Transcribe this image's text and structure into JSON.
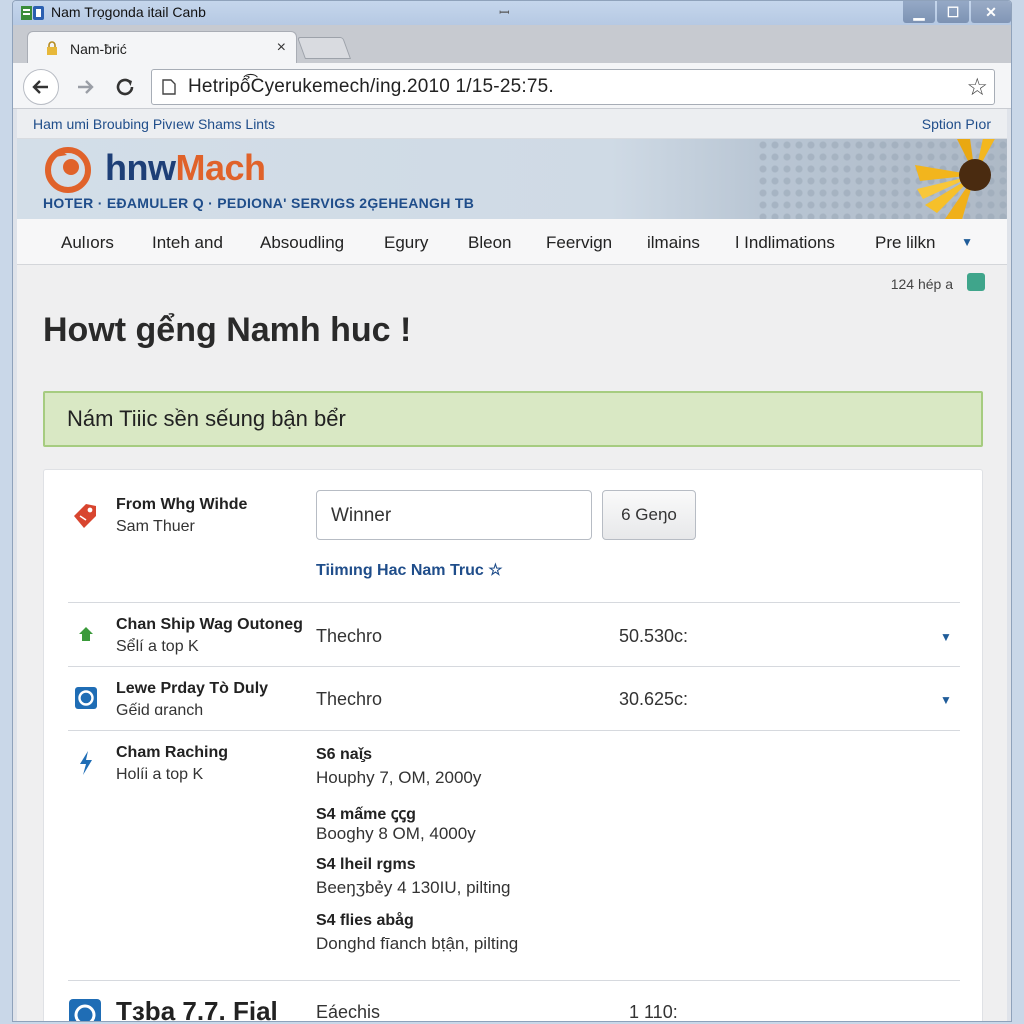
{
  "window": {
    "title": "Nam Trọgonda itail Canb",
    "mid_glyph": "ꟷ"
  },
  "tab": {
    "label": "Nam-ƀrić",
    "close": "×"
  },
  "toolbar": {
    "url": "Hetripổ͡Cyerukemech/ing.2010 1/15-25:75.",
    "star": "☆"
  },
  "page": {
    "topstrip": {
      "left": "Ham umi Broubing Pivıew Shams Lints",
      "right": "Sption Pıor"
    },
    "logo": {
      "part1": "hnw",
      "part2": "Mach"
    },
    "tagline": "HOTER  ·  EĐAMULER Q  ·  PEDIONA' SERVIGS    2ĢEHEANGH TB",
    "menu": [
      "Aulıors",
      "Inteh and",
      "Absoudling",
      "Egury",
      "Bleon",
      "Feervign",
      "ilmains",
      "ǀ Indlimations",
      "Pre lilkn"
    ],
    "subinfo": "124 hép a",
    "headline": "Howt gểng Namh huc !",
    "notice": "Nám Tiiic sền sếung bận bểr",
    "form": {
      "title": "From Whg Wihde",
      "subtitle": "Sam Thuer",
      "input_value": "Winner",
      "button": "6 Geŋo",
      "link": "Tiimıng Hac Nam Truc ☆"
    },
    "rows": [
      {
        "title": "Chan Ship Wag Outoneg",
        "subtitle": "Sểlí a top K",
        "value": "Thechro",
        "amount": "50.530c:"
      },
      {
        "title": "Lewe Prday Tò Duly",
        "subtitle": "Gếid ɑranch",
        "value": "Thechro",
        "amount": "30.625c:"
      }
    ],
    "detail": {
      "title": "Cham Raching",
      "subtitle": "Holíi a top K",
      "items": [
        {
          "h": "S6 naǐ̧s",
          "v": "Houphy 7, OM, 2000y"
        },
        {
          "h": "S4 mấme ꞔꞔg",
          "v": "Booghy 8 OM, 4000y"
        },
        {
          "h": "S4 lheil rgms",
          "v": "Beeŋʒbẻy 4 130IU, pilting"
        },
        {
          "h": "S4 flies abåg",
          "v": "Donghd fīanch bṭận, pilting"
        }
      ]
    },
    "bottom": {
      "title": "Tзba 7.7. Fial",
      "value": "Eáechis",
      "amount": "1 110:"
    }
  },
  "colors": {
    "accent": "#1f4d8a",
    "brand_orange": "#e0622a",
    "notice_bg": "#d9e8c4"
  }
}
